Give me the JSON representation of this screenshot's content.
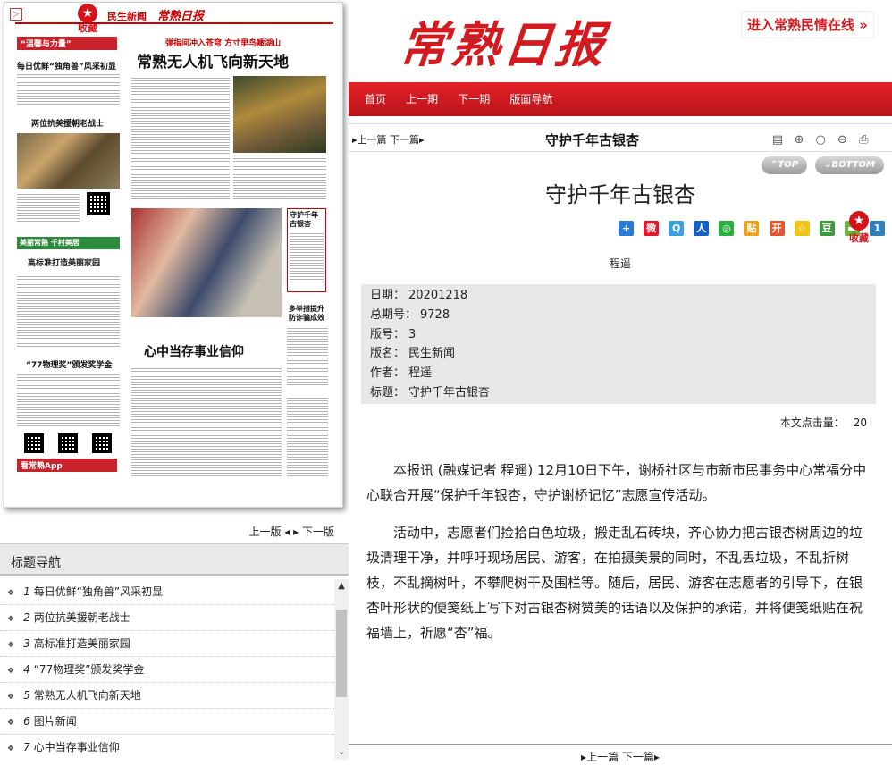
{
  "newspaper": {
    "page_name": "民生新闻",
    "logo": "常熟日报",
    "favorite": "收藏",
    "headline": "常熟无人机飞向新天地",
    "subhead": "弹指间冲入苍穹 方寸里鸟瞰湖山",
    "section1": "“温馨与力量”",
    "story1": "每日优鲜“独角兽”风采初显",
    "story2": "两位抗美援朝老战士",
    "story3": "高标准打造美丽家园",
    "story3_banner": "美丽常熟 千村美居",
    "story4": "“77物理奖”颁发奖学金",
    "story5": "心中当存事业信仰",
    "story6": "守护千年古银杏",
    "story7": "多举措提升防诈骗成效",
    "app_label": "看常熟App"
  },
  "left_pager": {
    "prev": "上一版",
    "next": "下一版"
  },
  "nav": {
    "title": "标题导航",
    "items": [
      {
        "num": "1",
        "label": "每日优鲜“独角兽”风采初显"
      },
      {
        "num": "2",
        "label": "两位抗美援朝老战士"
      },
      {
        "num": "3",
        "label": "高标准打造美丽家园"
      },
      {
        "num": "4",
        "label": "“77物理奖”颁发奖学金"
      },
      {
        "num": "5",
        "label": "常熟无人机飞向新天地"
      },
      {
        "num": "6",
        "label": "图片新闻"
      },
      {
        "num": "7",
        "label": "心中当存事业信仰"
      }
    ]
  },
  "header": {
    "site_logo": "常熟日报",
    "entry_link": "进入常熟民情在线"
  },
  "topnav": [
    "首页",
    "上一期",
    "下一期",
    "版面导航"
  ],
  "article_bar": {
    "prev": "上一篇",
    "next": "下一篇",
    "title": "守护千年古银杏"
  },
  "topbottom": {
    "top": "TOP",
    "bottom": "BOTTOM"
  },
  "article": {
    "headline": "守护千年古银杏",
    "author": "程遥",
    "favorite": "收藏",
    "meta": [
      {
        "label": "日期：",
        "value": "20201218"
      },
      {
        "label": "总期号：",
        "value": "9728"
      },
      {
        "label": "版号：",
        "value": "3"
      },
      {
        "label": "版名：",
        "value": "民生新闻"
      },
      {
        "label": "作者：",
        "value": "程遥"
      },
      {
        "label": "标题：",
        "value": "守护千年古银杏"
      }
    ],
    "clicks_label": "本文点击量：",
    "clicks": "20",
    "paragraphs": [
      "本报讯 (融媒记者 程遥) 12月10日下午，谢桥社区与市新市民事务中心常福分中心联合开展“保护千年银杏，守护谢桥记忆”志愿宣传活动。",
      "活动中，志愿者们捡拾白色垃圾，搬走乱石砖块，齐心协力把古银杏树周边的垃圾清理干净，并呼吁现场居民、游客，在拍摄美景的同时，不乱丢垃圾，不乱折树枝，不乱摘树叶，不攀爬树干及围栏等。随后，居民、游客在志愿者的引导下，在银杏叶形状的便笺纸上写下对古银杏树赞美的话语以及保护的承诺，并将便笺纸贴在祝福墙上，祈愿“杏”福。"
    ]
  },
  "bottom_pager": {
    "prev": "上一篇",
    "next": "下一篇"
  },
  "colors": {
    "brand_red": "#d21a1f",
    "nav_bg": "#e9e9e9",
    "meta_bg": "#e8e8e8"
  }
}
